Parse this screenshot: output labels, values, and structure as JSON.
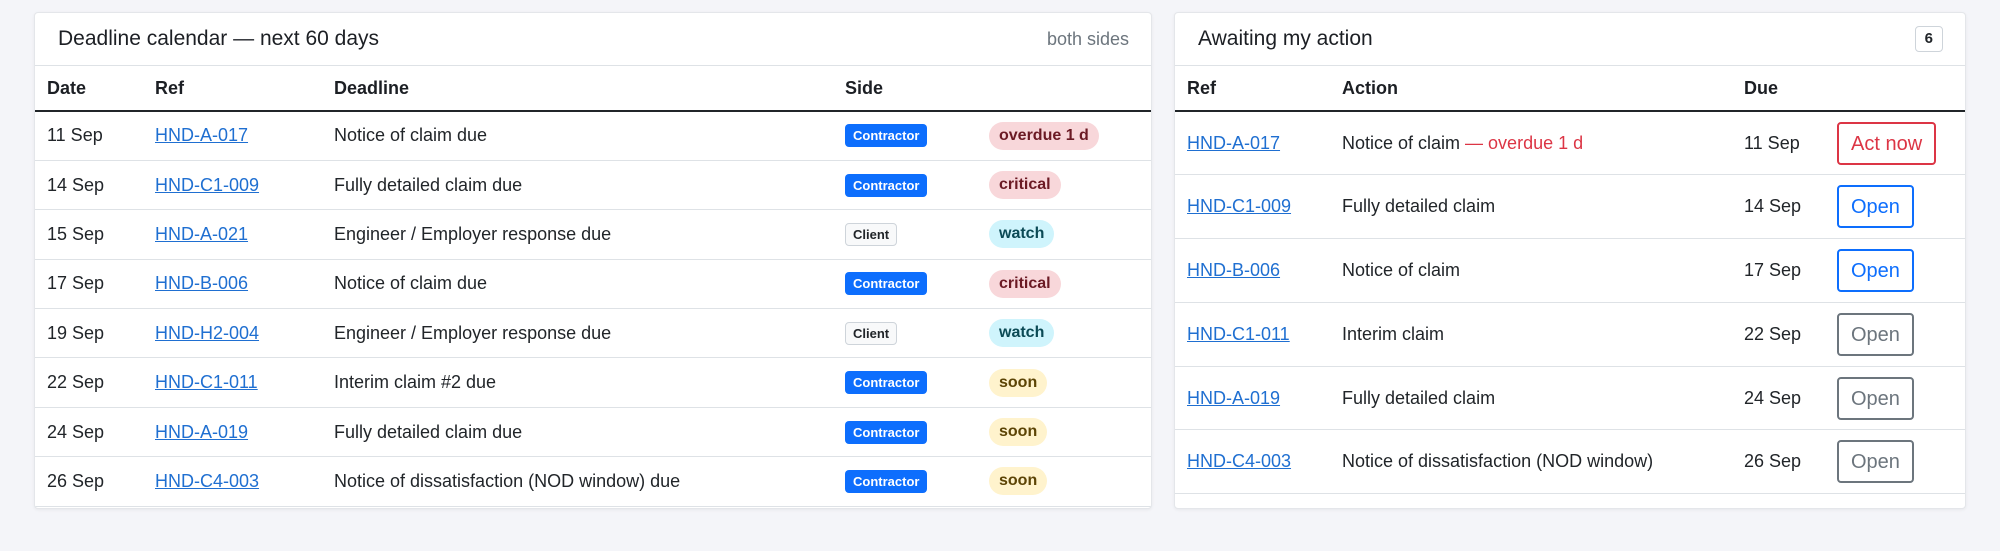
{
  "deadline_card": {
    "title": "Deadline calendar — next 60 days",
    "note": "both sides",
    "headers": {
      "date": "Date",
      "ref": "Ref",
      "deadline": "Deadline",
      "side": "Side",
      "status": ""
    },
    "rows": [
      {
        "date": "11 Sep",
        "ref": "HND-A-017",
        "deadline": "Notice of claim due",
        "side": "Contractor",
        "status": "overdue 1 d",
        "status_kind": "overdue"
      },
      {
        "date": "14 Sep",
        "ref": "HND-C1-009",
        "deadline": "Fully detailed claim due",
        "side": "Contractor",
        "status": "critical",
        "status_kind": "critical"
      },
      {
        "date": "15 Sep",
        "ref": "HND-A-021",
        "deadline": "Engineer / Employer response due",
        "side": "Client",
        "status": "watch",
        "status_kind": "watch"
      },
      {
        "date": "17 Sep",
        "ref": "HND-B-006",
        "deadline": "Notice of claim due",
        "side": "Contractor",
        "status": "critical",
        "status_kind": "critical"
      },
      {
        "date": "19 Sep",
        "ref": "HND-H2-004",
        "deadline": "Engineer / Employer response due",
        "side": "Client",
        "status": "watch",
        "status_kind": "watch"
      },
      {
        "date": "22 Sep",
        "ref": "HND-C1-011",
        "deadline": "Interim claim #2 due",
        "side": "Contractor",
        "status": "soon",
        "status_kind": "soon"
      },
      {
        "date": "24 Sep",
        "ref": "HND-A-019",
        "deadline": "Fully detailed claim due",
        "side": "Contractor",
        "status": "soon",
        "status_kind": "soon"
      },
      {
        "date": "26 Sep",
        "ref": "HND-C4-003",
        "deadline": "Notice of dissatisfaction (NOD window) due",
        "side": "Contractor",
        "status": "soon",
        "status_kind": "soon"
      }
    ]
  },
  "action_card": {
    "title": "Awaiting my action",
    "count": "6",
    "headers": {
      "ref": "Ref",
      "action": "Action",
      "due": "Due",
      "button": ""
    },
    "rows": [
      {
        "ref": "HND-A-017",
        "action": "Notice of claim",
        "action_note": " — overdue 1 d",
        "due": "11 Sep",
        "button": "Act now",
        "button_kind": "danger"
      },
      {
        "ref": "HND-C1-009",
        "action": "Fully detailed claim",
        "action_note": "",
        "due": "14 Sep",
        "button": "Open",
        "button_kind": "primary"
      },
      {
        "ref": "HND-B-006",
        "action": "Notice of claim",
        "action_note": "",
        "due": "17 Sep",
        "button": "Open",
        "button_kind": "primary"
      },
      {
        "ref": "HND-C1-011",
        "action": "Interim claim",
        "action_note": "",
        "due": "22 Sep",
        "button": "Open",
        "button_kind": "secondary"
      },
      {
        "ref": "HND-A-019",
        "action": "Fully detailed claim",
        "action_note": "",
        "due": "24 Sep",
        "button": "Open",
        "button_kind": "secondary"
      },
      {
        "ref": "HND-C4-003",
        "action": "Notice of dissatisfaction (NOD window)",
        "action_note": "",
        "due": "26 Sep",
        "button": "Open",
        "button_kind": "secondary"
      }
    ]
  },
  "colors": {
    "page_bg": "#f4f5f9",
    "link": "#1f6fd1",
    "contractor_badge": "#0d6efd",
    "danger": "#dc3545",
    "primary": "#0d6efd",
    "secondary": "#6c757d"
  }
}
